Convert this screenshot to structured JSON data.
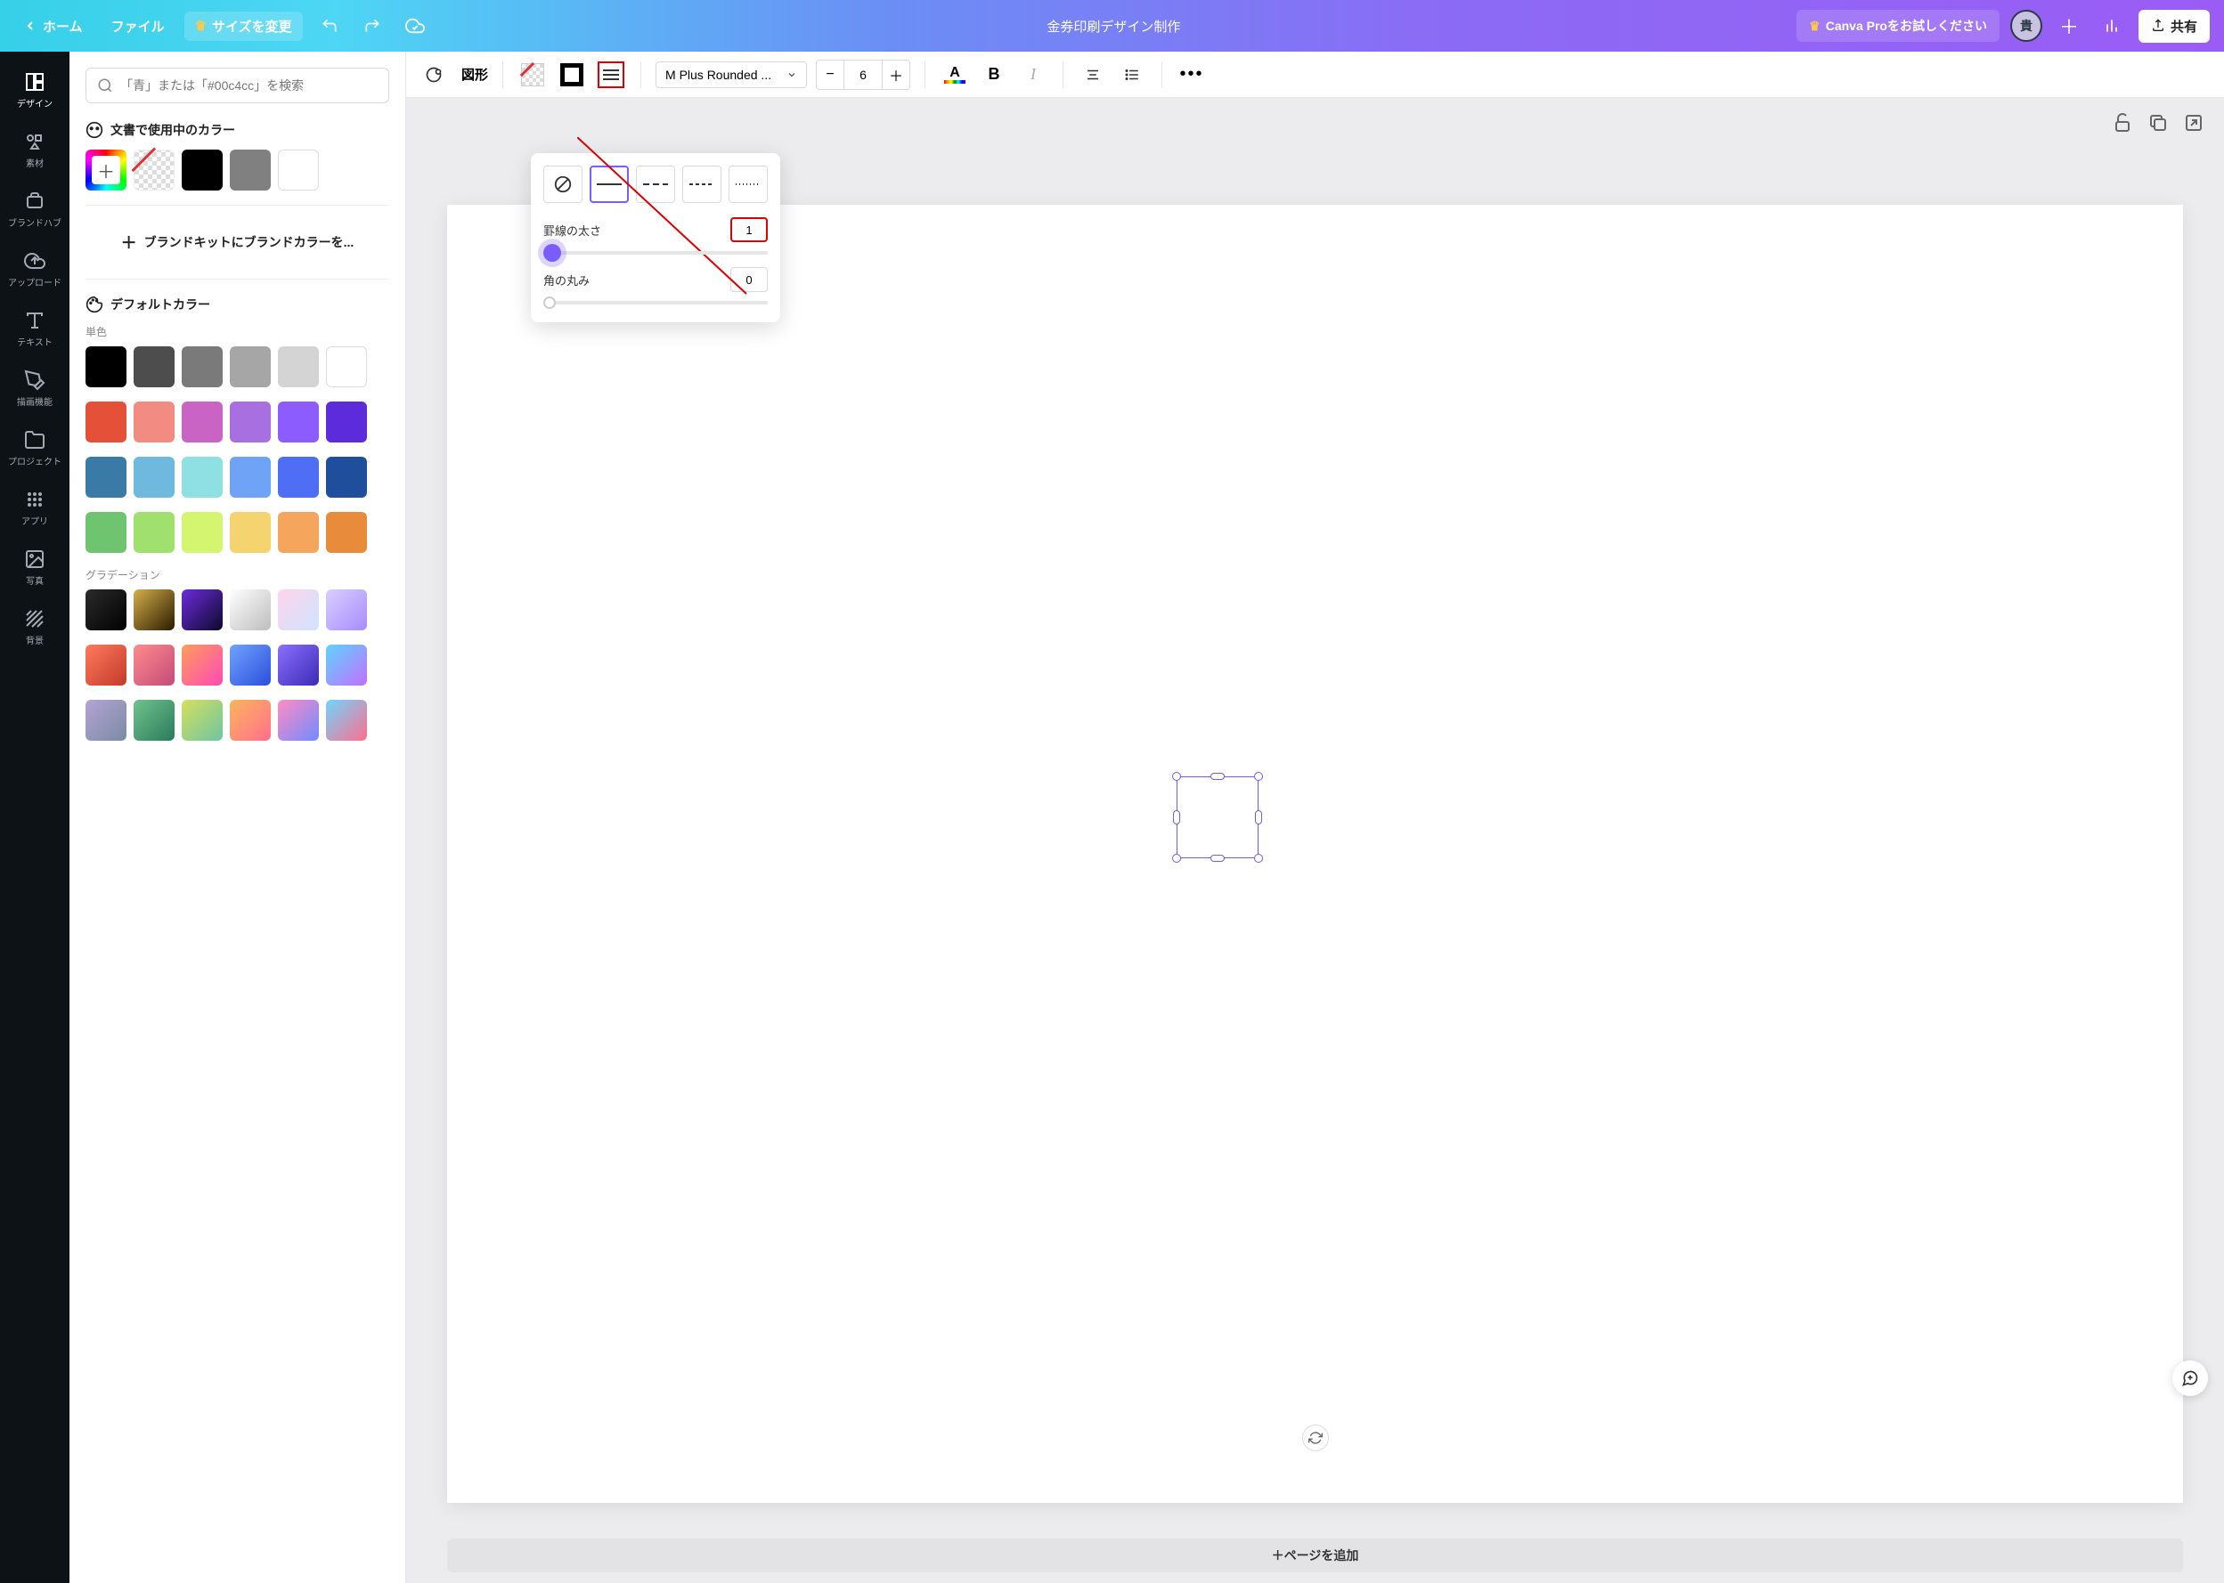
{
  "topbar": {
    "home": "ホーム",
    "file": "ファイル",
    "resize": "サイズを変更",
    "title": "金券印刷デザイン制作",
    "pro": "Canva Proをお試しください",
    "avatar": "貴",
    "share": "共有"
  },
  "rail": {
    "design": "デザイン",
    "elements": "素材",
    "brandhub": "ブランドハブ",
    "upload": "アップロード",
    "text": "テキスト",
    "draw": "描画機能",
    "projects": "プロジェクト",
    "apps": "アプリ",
    "photo": "写真",
    "background": "背景"
  },
  "side": {
    "search_placeholder": "「青」または「#00c4cc」を検索",
    "in_doc_colors": "文書で使用中のカラー",
    "brand_kit": "ブランドキットにブランドカラーを...",
    "default_colors": "デフォルトカラー",
    "solid": "単色",
    "gradient": "グラデーション"
  },
  "toolbar": {
    "shape": "図形",
    "font": "M Plus Rounded ...",
    "font_size": "6",
    "bold": "B",
    "italic": "I"
  },
  "popup": {
    "border_weight": "罫線の太さ",
    "border_weight_val": "1",
    "corner_radius": "角の丸み",
    "corner_radius_val": "0"
  },
  "canvas": {
    "add_page": "＋ページを追加"
  },
  "colors": {
    "doc": [
      "#000000",
      "#808080",
      "#ffffff"
    ],
    "solid_rows": [
      [
        "#000000",
        "#4d4d4d",
        "#7a7a7a",
        "#a6a6a6",
        "#d4d4d4",
        "#ffffff"
      ],
      [
        "#e55039",
        "#f28c83",
        "#c964c4",
        "#a76fe0",
        "#8c5cff",
        "#5b2bdc"
      ],
      [
        "#3a7aa6",
        "#6fb9de",
        "#8ee0e3",
        "#6fa3f5",
        "#4d6ef5",
        "#1f4e9c"
      ],
      [
        "#6fc46f",
        "#9fe06f",
        "#d4f56f",
        "#f5d46f",
        "#f5a65c",
        "#e88b3a"
      ]
    ],
    "gradient_rows": [
      [
        "linear-gradient(135deg,#2b2b2b,#000)",
        "linear-gradient(135deg,#d4b04a,#2b1a00)",
        "linear-gradient(135deg,#6f2bdc,#0a0a2b)",
        "linear-gradient(135deg,#fff,#bdbdbd)",
        "linear-gradient(135deg,#ffd4ec,#cfe4ff)",
        "linear-gradient(135deg,#d9cfff,#a68cff)"
      ],
      [
        "linear-gradient(135deg,#ff7a5c,#c43a2b)",
        "linear-gradient(135deg,#ff8c8c,#c44a7a)",
        "linear-gradient(135deg,#ff9c5c,#ff4ab4)",
        "linear-gradient(135deg,#6fa3ff,#2b4edc)",
        "linear-gradient(135deg,#8c6fff,#3a2bb4)",
        "linear-gradient(135deg,#5cd4ff,#c46fff)"
      ],
      [
        "linear-gradient(135deg,#b4a3d4,#7a8ca3)",
        "linear-gradient(135deg,#6fc48c,#2b7a5c)",
        "linear-gradient(135deg,#d4e05c,#6fc4a3)",
        "linear-gradient(135deg,#ffb45c,#ff6f8c)",
        "linear-gradient(135deg,#ff8cc4,#6f8cff)",
        "linear-gradient(135deg,#6fd4ff,#ff6f8c)"
      ]
    ]
  }
}
